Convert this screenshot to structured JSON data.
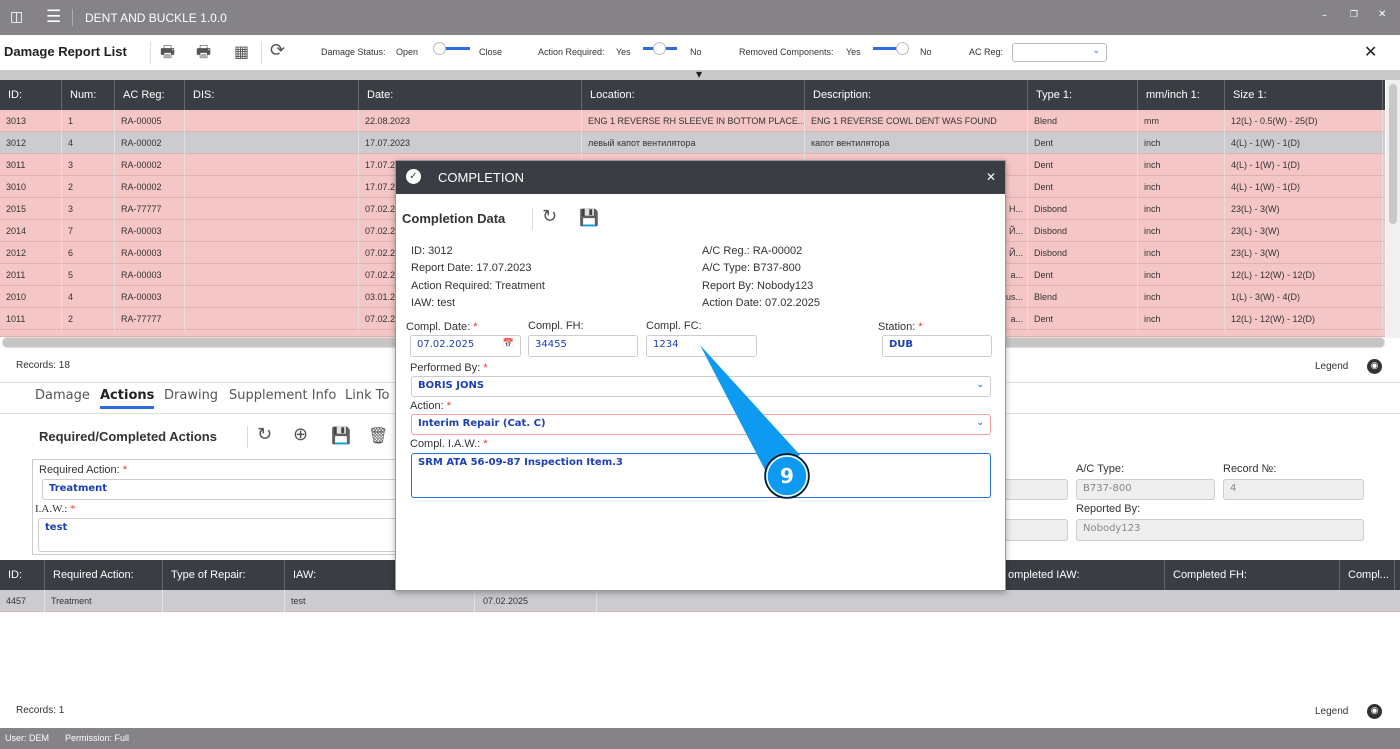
{
  "app": {
    "title": "DENT AND BUCKLE 1.0.0"
  },
  "toolbar": {
    "title": "Damage Report List",
    "damage_status": {
      "label": "Damage Status:",
      "left": "Open",
      "right": "Close",
      "value": "Open"
    },
    "action_required": {
      "label": "Action Required:",
      "left": "Yes",
      "right": "No",
      "value": "middle"
    },
    "removed_components": {
      "label": "Removed Components:",
      "left": "Yes",
      "right": "No",
      "value": "No"
    },
    "ac_reg": {
      "label": "AC Reg:",
      "value": ""
    }
  },
  "damage_table": {
    "columns": [
      "ID:",
      "Num:",
      "AC Reg:",
      "DIS:",
      "Date:",
      "Location:",
      "Description:",
      "Type 1:",
      "mm/inch 1:",
      "Size 1:"
    ],
    "rows": [
      {
        "id": "3013",
        "num": "1",
        "reg": "RA-00005",
        "dis": "",
        "date": "22.08.2023",
        "loc": "ENG 1 REVERSE RH SLEEVE IN BOTTOM PLACE...",
        "desc": "ENG 1 REVERSE COWL DENT WAS FOUND",
        "type": "Blend",
        "unit": "mm",
        "size": "12(L) - 0.5(W) - 25(D)"
      },
      {
        "id": "3012",
        "num": "4",
        "reg": "RA-00002",
        "dis": "",
        "date": "17.07.2023",
        "loc": "левый капот вентилятора",
        "desc": "капот вентилятора",
        "type": "Dent",
        "unit": "inch",
        "size": "4(L) - 1(W) - 1(D)",
        "selected": true
      },
      {
        "id": "3011",
        "num": "3",
        "reg": "RA-00002",
        "dis": "",
        "date": "17.07.2",
        "loc": "",
        "desc": "",
        "type": "Dent",
        "unit": "inch",
        "size": "4(L) - 1(W) - 1(D)"
      },
      {
        "id": "3010",
        "num": "2",
        "reg": "RA-00002",
        "dis": "",
        "date": "17.07.2",
        "loc": "",
        "desc": "",
        "type": "Dent",
        "unit": "inch",
        "size": "4(L) - 1(W) - 1(D)"
      },
      {
        "id": "2015",
        "num": "3",
        "reg": "RA-77777",
        "dis": "",
        "date": "07.02.2",
        "loc": "",
        "desc": "Н...",
        "type": "Disbond",
        "unit": "inch",
        "size": "23(L) - 3(W)"
      },
      {
        "id": "2014",
        "num": "7",
        "reg": "RA-00003",
        "dis": "",
        "date": "07.02.2",
        "loc": "",
        "desc": "Й...",
        "type": "Disbond",
        "unit": "inch",
        "size": "23(L) - 3(W)"
      },
      {
        "id": "2012",
        "num": "6",
        "reg": "RA-00003",
        "dis": "",
        "date": "07.02.2",
        "loc": "",
        "desc": "Й...",
        "type": "Disbond",
        "unit": "inch",
        "size": "23(L) - 3(W)"
      },
      {
        "id": "2011",
        "num": "5",
        "reg": "RA-00003",
        "dis": "",
        "date": "07.02.2",
        "loc": "",
        "desc": "а...",
        "type": "Dent",
        "unit": "inch",
        "size": "12(L) - 12(W) - 12(D)"
      },
      {
        "id": "2010",
        "num": "4",
        "reg": "RA-00003",
        "dis": "",
        "date": "03.01.2",
        "loc": "",
        "desc": "us...",
        "type": "Blend",
        "unit": "inch",
        "size": "1(L) - 3(W) - 4(D)"
      },
      {
        "id": "1011",
        "num": "2",
        "reg": "RA-77777",
        "dis": "",
        "date": "07.02.2",
        "loc": "",
        "desc": "а...",
        "type": "Dent",
        "unit": "inch",
        "size": "12(L) - 12(W) - 12(D)"
      }
    ],
    "records": "Records: 18",
    "legend": "Legend"
  },
  "tabs": [
    {
      "label": "Damage"
    },
    {
      "label": "Actions",
      "active": true
    },
    {
      "label": "Drawing"
    },
    {
      "label": "Supplement Info"
    },
    {
      "label": "Link To"
    }
  ],
  "actions": {
    "title": "Required/Completed Actions",
    "required_action_label": "Required Action:",
    "required_action": "Treatment",
    "iaw_label": "I.A.W.:",
    "iaw": "test",
    "ac_type_label": "A/C Type:",
    "ac_type": "B737-800",
    "record_no_label": "Record №:",
    "record_no": "4",
    "reported_by_label": "Reported By:",
    "reported_by": "Nobody123"
  },
  "actions_table": {
    "columns": [
      "ID:",
      "Required Action:",
      "Type of Repair:",
      "IAW:",
      "ompleted IAW:",
      "Completed FH:",
      "Compl..."
    ],
    "rows": [
      {
        "id": "4457",
        "action": "Treatment",
        "repair": "",
        "iaw": "test",
        "date": "07.02.2025"
      }
    ],
    "records": "Records: 1",
    "legend": "Legend"
  },
  "dialog": {
    "title": "COMPLETION",
    "subtitle": "Completion Data",
    "info_left": [
      "ID: 3012",
      "Report Date: 17.07.2023",
      "Action Required: Treatment",
      "IAW: test"
    ],
    "info_right": [
      "A/C Reg.: RA-00002",
      "A/C Type: B737-800",
      "Report By: Nobody123",
      "Action Date: 07.02.2025"
    ],
    "compl_date_label": "Compl. Date:",
    "compl_date": "07.02.2025",
    "compl_fh_label": "Compl. FH:",
    "compl_fh": "34455",
    "compl_fc_label": "Compl. FC:",
    "compl_fc": "1234",
    "station_label": "Station:",
    "station": "DUB",
    "performed_by_label": "Performed By:",
    "performed_by": "BORIS JONS",
    "action_label": "Action:",
    "action": "Interim Repair (Cat. C)",
    "compl_iaw_label": "Compl. I.A.W.:",
    "compl_iaw": "SRM ATA 56-09-87 Inspection Item.3"
  },
  "callout": {
    "number": "9",
    "color": "#0d9af0"
  },
  "status": {
    "user": "User: DEM",
    "permission": "Permission: Full"
  },
  "colors": {
    "row_pink": "#f5c6c6",
    "row_selected": "#cccbcf",
    "header_dark": "#3a3d44",
    "accent": "#2a6ee0"
  }
}
